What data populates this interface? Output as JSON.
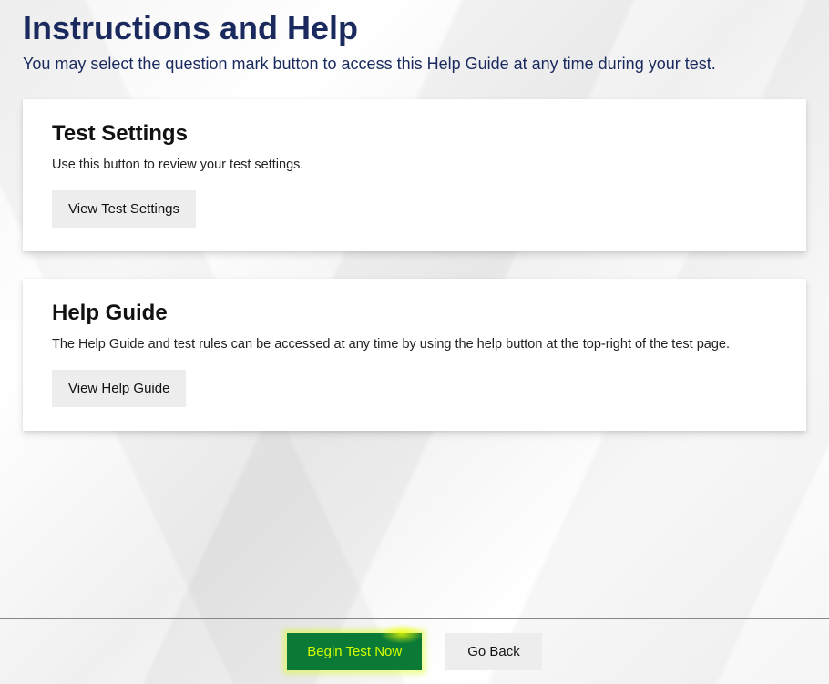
{
  "header": {
    "title": "Instructions and Help",
    "subtitle": "You may select the question mark button to access this Help Guide at any time during your test."
  },
  "sections": {
    "test_settings": {
      "title": "Test Settings",
      "description": "Use this button to review your test settings.",
      "button_label": "View Test Settings"
    },
    "help_guide": {
      "title": "Help Guide",
      "description": "The Help Guide and test rules can be accessed at any time by using the help button at the top-right of the test page.",
      "button_label": "View Help Guide"
    }
  },
  "footer": {
    "begin_label": "Begin Test Now",
    "goback_label": "Go Back"
  },
  "colors": {
    "heading": "#1a2a5e",
    "begin_bg": "#0a7a36",
    "begin_text": "#d4ff00"
  }
}
